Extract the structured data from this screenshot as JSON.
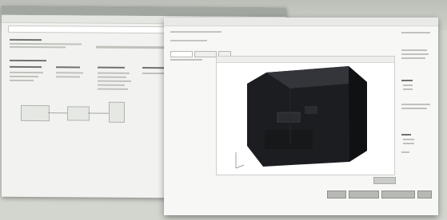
{
  "screen": {
    "description_hidden": ""
  }
}
